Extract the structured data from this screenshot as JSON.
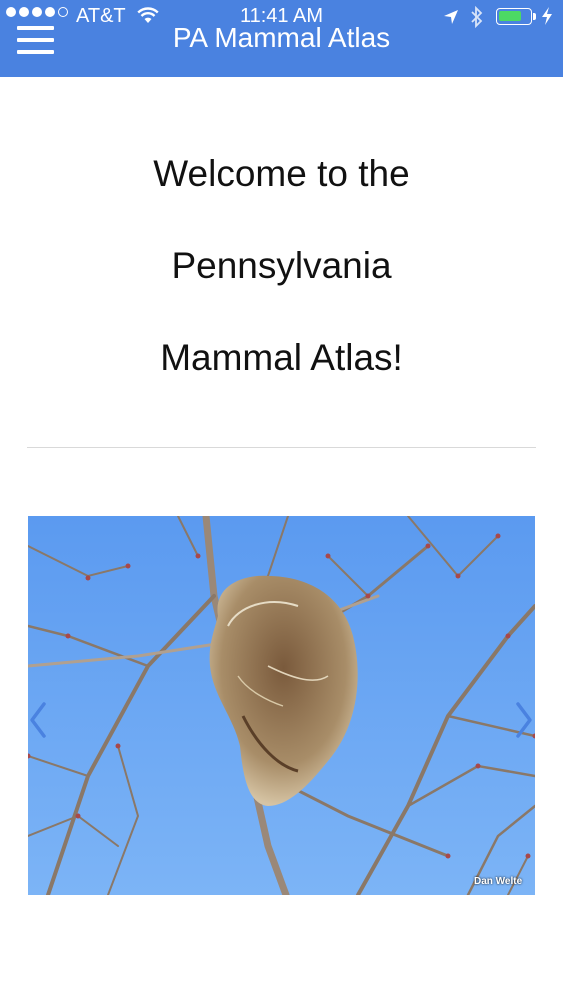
{
  "status_bar": {
    "carrier": "AT&T",
    "time": "11:41 AM",
    "battery_level_fraction": 0.75,
    "icons": [
      "signal-icon",
      "wifi-icon",
      "location-arrow-icon",
      "bluetooth-icon",
      "battery-icon",
      "charging-icon"
    ]
  },
  "app_bar": {
    "title": "PA Mammal Atlas",
    "menu_icon": "hamburger-menu-icon",
    "color": "#4a82e0"
  },
  "welcome": {
    "line1": "Welcome to the",
    "line2": "Pennsylvania",
    "line3": "Mammal Atlas!"
  },
  "carousel": {
    "photo_credit": "Dan Welte",
    "prev_icon": "chevron-left-icon",
    "next_icon": "chevron-right-icon"
  }
}
